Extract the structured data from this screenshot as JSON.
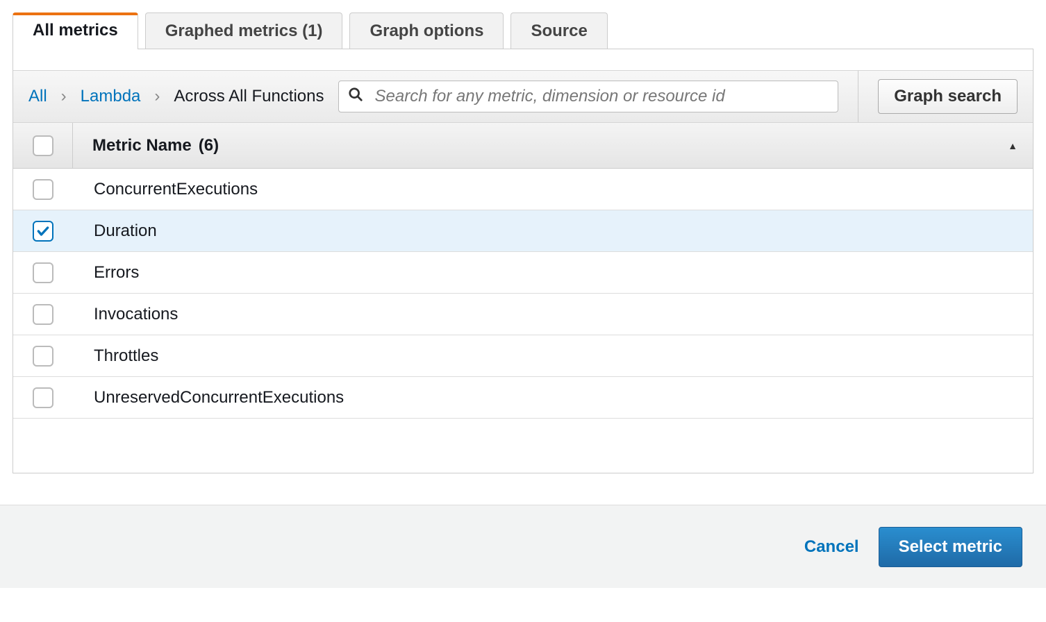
{
  "tabs": {
    "all_metrics": "All metrics",
    "graphed_metrics": "Graphed metrics (1)",
    "graph_options": "Graph options",
    "source": "Source"
  },
  "breadcrumb": {
    "all": "All",
    "lambda": "Lambda",
    "current": "Across All Functions"
  },
  "search": {
    "placeholder": "Search for any metric, dimension or resource id"
  },
  "buttons": {
    "graph_search": "Graph search",
    "cancel": "Cancel",
    "select_metric": "Select metric"
  },
  "table": {
    "header_label": "Metric Name",
    "header_count": "(6)",
    "rows": [
      {
        "name": "ConcurrentExecutions",
        "selected": false
      },
      {
        "name": "Duration",
        "selected": true
      },
      {
        "name": "Errors",
        "selected": false
      },
      {
        "name": "Invocations",
        "selected": false
      },
      {
        "name": "Throttles",
        "selected": false
      },
      {
        "name": "UnreservedConcurrentExecutions",
        "selected": false
      }
    ]
  }
}
